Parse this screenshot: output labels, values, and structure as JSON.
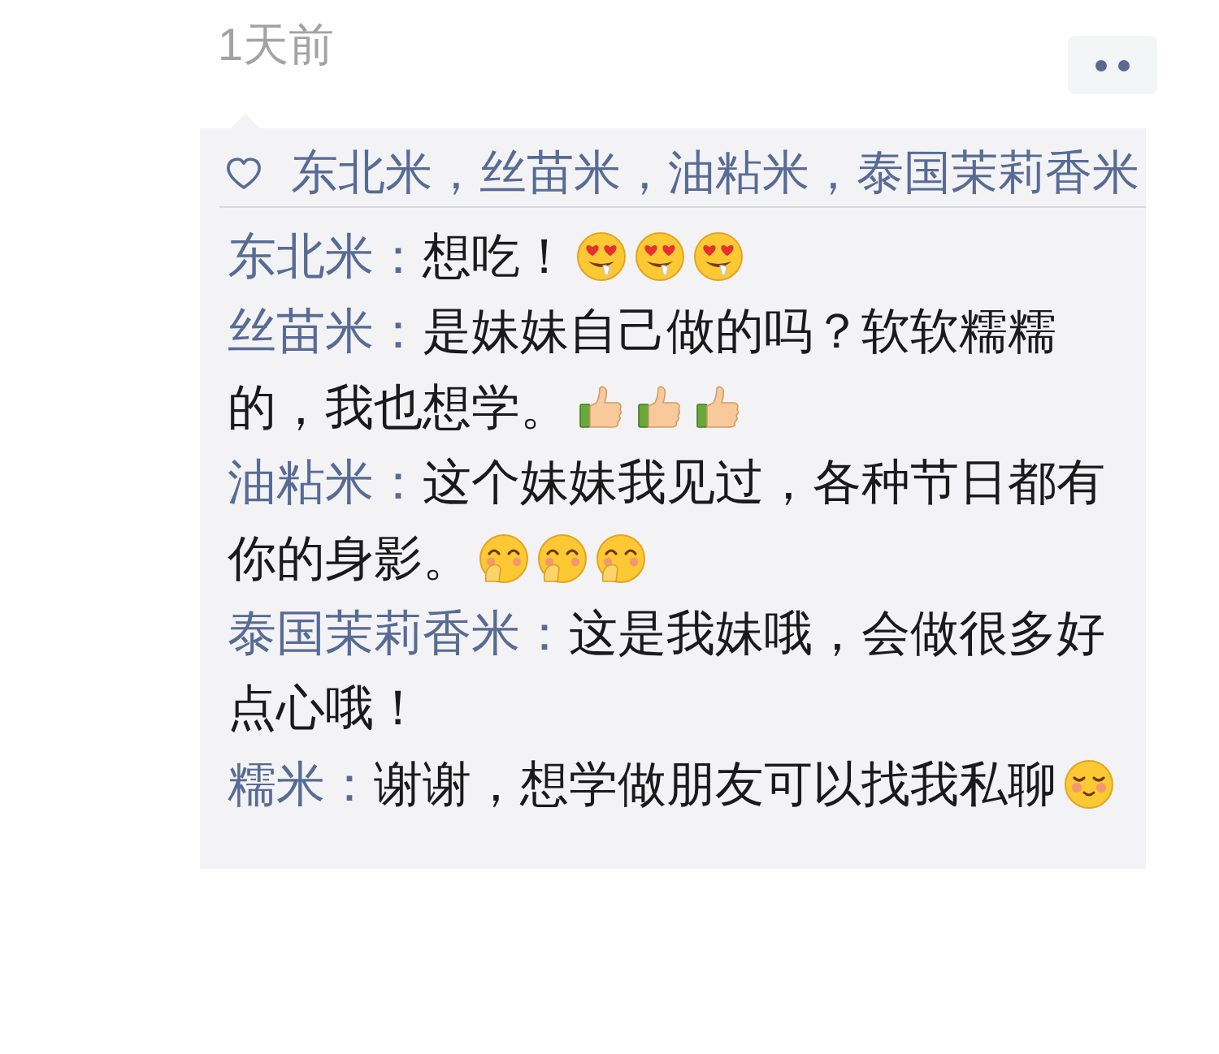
{
  "timestamp": "1天前",
  "likes": {
    "names": "东北米，丝苗米，油粘米，泰国茉莉香米"
  },
  "comments": [
    {
      "author": "东北米：",
      "parts": [
        {
          "kind": "text",
          "text": "想吃！"
        },
        {
          "kind": "drool"
        },
        {
          "kind": "drool"
        },
        {
          "kind": "drool"
        }
      ]
    },
    {
      "author": "丝苗米：",
      "parts": [
        {
          "kind": "text",
          "text": "是妹妹自己做的吗？软软糯糯的，我也想学。"
        },
        {
          "kind": "thumbsup"
        },
        {
          "kind": "thumbsup"
        },
        {
          "kind": "thumbsup"
        }
      ]
    },
    {
      "author": "油粘米：",
      "parts": [
        {
          "kind": "text",
          "text": "这个妹妹我见过，各种节日都有你的身影。"
        },
        {
          "kind": "giggle"
        },
        {
          "kind": "giggle"
        },
        {
          "kind": "giggle"
        }
      ]
    },
    {
      "author": "泰国茉莉香米：",
      "parts": [
        {
          "kind": "text",
          "text": "这是我妹哦，会做很多好点心哦！"
        }
      ]
    },
    {
      "author": "糯米：",
      "parts": [
        {
          "kind": "text",
          "text": "谢谢，想学做朋友可以找我私聊"
        },
        {
          "kind": "bashful"
        }
      ]
    }
  ]
}
